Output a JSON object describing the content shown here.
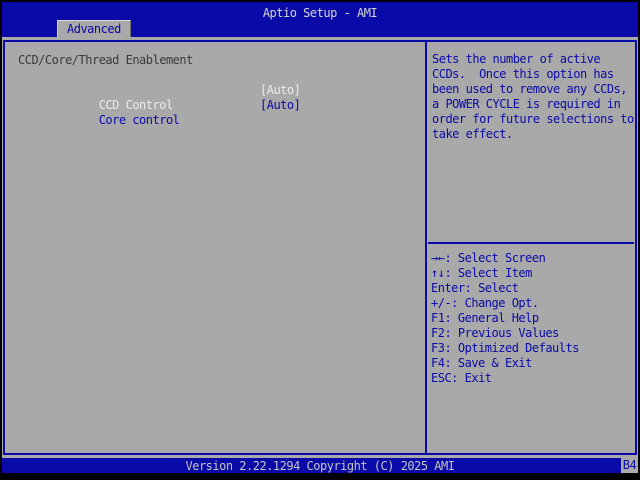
{
  "header": {
    "title": "Aptio Setup - AMI",
    "tab": {
      "label": "Advanced",
      "active": true
    }
  },
  "main": {
    "section_title": "CCD/Core/Thread Enablement",
    "items": [
      {
        "label": "CCD Control",
        "value": "[Auto]",
        "selected": true
      },
      {
        "label": "Core control",
        "value": "[Auto]",
        "selected": false
      }
    ]
  },
  "help": {
    "lines": [
      "Sets the number of active",
      "CCDs.  Once this option has",
      "been used to remove any CCDs,",
      "a POWER CYCLE is required in",
      "order for future selections to",
      "take effect."
    ]
  },
  "hints": [
    "→←: Select Screen",
    "↑↓: Select Item",
    "Enter: Select",
    "+/-: Change Opt.",
    "F1: General Help",
    "F2: Previous Values",
    "F3: Optimized Defaults",
    "F4: Save & Exit",
    "ESC: Exit"
  ],
  "footer": {
    "version_text": "Version 2.22.1294 Copyright (C) 2025 AMI",
    "badge": "B4"
  },
  "colors": {
    "bar_blue": "#0a0aa8",
    "panel_gray": "#a9a9a9",
    "text_blue": "#0a0aa8",
    "selected_text": "#ececec",
    "heading_text": "#3a3a3a"
  }
}
